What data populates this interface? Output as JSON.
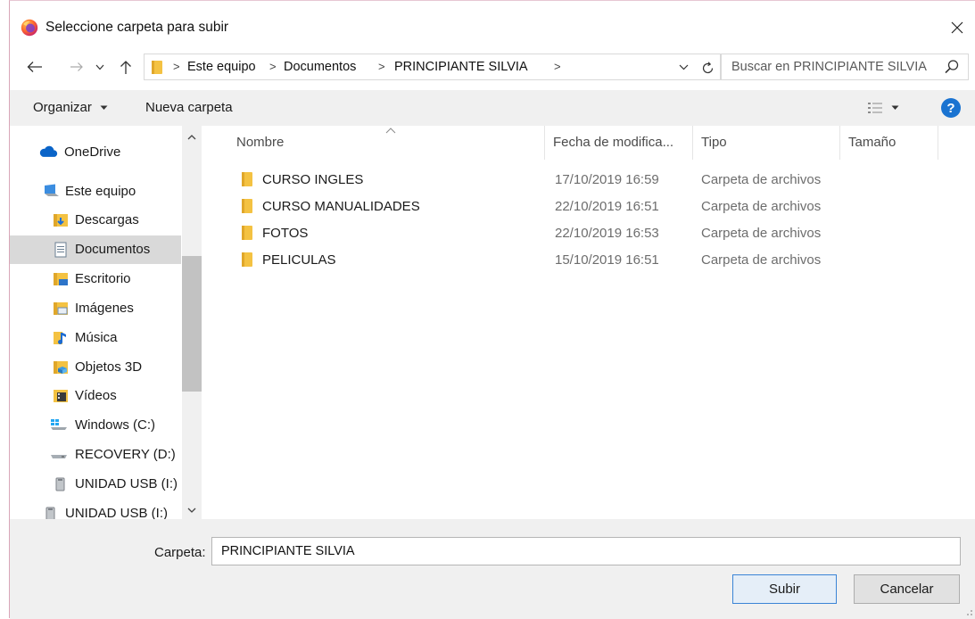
{
  "window": {
    "title": "Seleccione carpeta para subir"
  },
  "address": {
    "breadcrumbs": [
      "Este equipo",
      "Documentos",
      "PRINCIPIANTE SILVIA"
    ]
  },
  "search": {
    "placeholder": "Buscar en PRINCIPIANTE SILVIA"
  },
  "toolbar": {
    "organize_label": "Organizar",
    "new_folder_label": "Nueva carpeta",
    "help_label": "?"
  },
  "nav": {
    "items": [
      {
        "label": "OneDrive",
        "icon": "cloud-icon"
      },
      {
        "label": "Este equipo",
        "icon": "computer-icon"
      },
      {
        "label": "Descargas",
        "icon": "downloads-folder-icon"
      },
      {
        "label": "Documentos",
        "icon": "documents-folder-icon",
        "selected": true
      },
      {
        "label": "Escritorio",
        "icon": "desktop-folder-icon"
      },
      {
        "label": "Imágenes",
        "icon": "pictures-folder-icon"
      },
      {
        "label": "Música",
        "icon": "music-folder-icon"
      },
      {
        "label": "Objetos 3D",
        "icon": "3d-objects-folder-icon"
      },
      {
        "label": "Vídeos",
        "icon": "videos-folder-icon"
      },
      {
        "label": "Windows (C:)",
        "icon": "windows-drive-icon"
      },
      {
        "label": "RECOVERY (D:)",
        "icon": "drive-icon"
      },
      {
        "label": "UNIDAD USB (I:)",
        "icon": "usb-drive-icon"
      },
      {
        "label": "UNIDAD USB (I:)",
        "icon": "usb-drive-icon"
      }
    ]
  },
  "columns": {
    "name": "Nombre",
    "date": "Fecha de modifica...",
    "type": "Tipo",
    "size": "Tamaño"
  },
  "files": [
    {
      "name": "CURSO INGLES",
      "date": "17/10/2019 16:59",
      "type": "Carpeta de archivos"
    },
    {
      "name": "CURSO MANUALIDADES",
      "date": "22/10/2019 16:51",
      "type": "Carpeta de archivos"
    },
    {
      "name": "FOTOS",
      "date": "22/10/2019 16:53",
      "type": "Carpeta de archivos"
    },
    {
      "name": "PELICULAS",
      "date": "15/10/2019 16:51",
      "type": "Carpeta de archivos"
    }
  ],
  "footer": {
    "folder_label": "Carpeta:",
    "folder_value": "PRINCIPIANTE SILVIA",
    "submit_label": "Subir",
    "cancel_label": "Cancelar"
  },
  "colors": {
    "folder": "#f4c242",
    "accent": "#1a73d1",
    "selection": "#d9d9d9"
  }
}
